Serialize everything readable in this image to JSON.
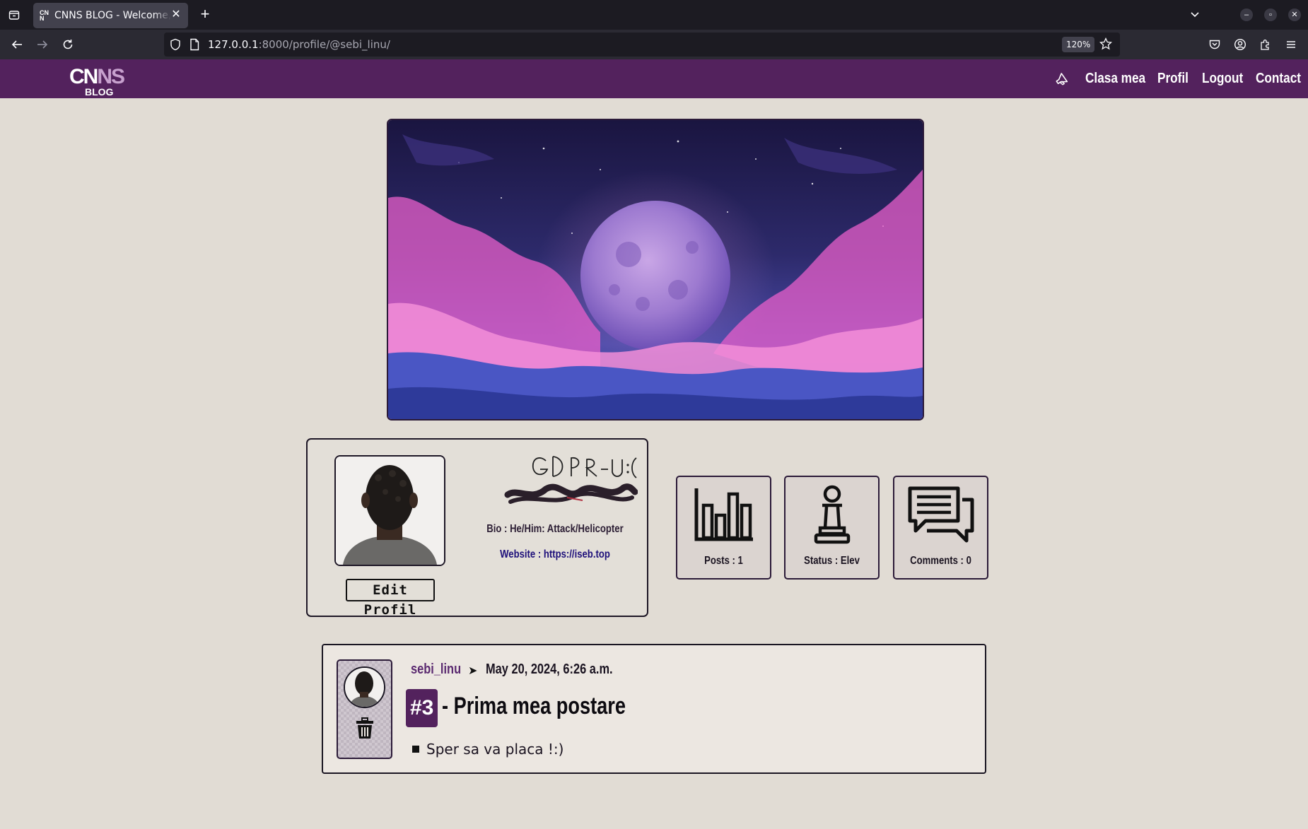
{
  "browser": {
    "tab_title": "CNNS BLOG - Welcome, s",
    "url_host": "127.0.0.1",
    "url_rest": ":8000/profile/@sebi_linu/",
    "zoom": "120%"
  },
  "site": {
    "logo_main": "CNNS",
    "logo_sub": "BLOG",
    "menu": [
      {
        "label": "Clasa mea"
      },
      {
        "label": "Profil"
      },
      {
        "label": "Logout"
      },
      {
        "label": "Contact"
      }
    ],
    "accent": "#53225d"
  },
  "profile": {
    "signature_text": "GDPR-U :(",
    "bio": "Bio : He/Him: Attack/Helicopter",
    "website": "Website : https://iseb.top",
    "edit_label": "Edit Profil"
  },
  "stats": [
    {
      "icon": "bar-chart-icon",
      "label": "Posts :  1"
    },
    {
      "icon": "chess-pawn-icon",
      "label": "Status : Elev"
    },
    {
      "icon": "comments-icon",
      "label": "Comments :  0"
    }
  ],
  "post": {
    "author": "sebi_linu",
    "arrow": "➤",
    "date": "May 20, 2024, 6:26 a.m.",
    "number": "#3",
    "title": "- Prima mea postare",
    "body": "Sper sa va placa !:)"
  }
}
